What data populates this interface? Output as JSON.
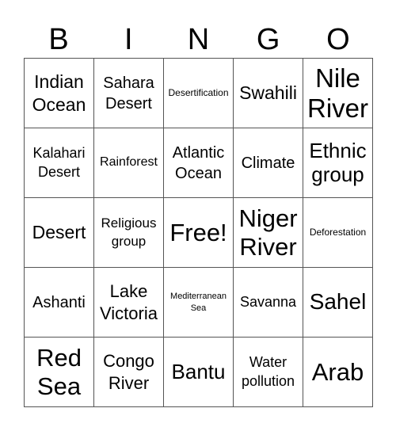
{
  "header": {
    "letters": [
      "B",
      "I",
      "N",
      "G",
      "O"
    ]
  },
  "card": {
    "rows": [
      [
        "Indian Ocean",
        "Sahara Desert",
        "Desertification",
        "Swahili",
        "Nile River"
      ],
      [
        "Kalahari Desert",
        "Rainforest",
        "Atlantic Ocean",
        "Climate",
        "Ethnic group"
      ],
      [
        "Desert",
        "Religious group",
        "Free!",
        "Niger River",
        "Deforestation"
      ],
      [
        "Ashanti",
        "Lake Victoria",
        "Mediterranean Sea",
        "Savanna",
        "Sahel"
      ],
      [
        "Red Sea",
        "Congo River",
        "Bantu",
        "Water pollution",
        "Arab"
      ]
    ],
    "free_space": "Free!"
  }
}
